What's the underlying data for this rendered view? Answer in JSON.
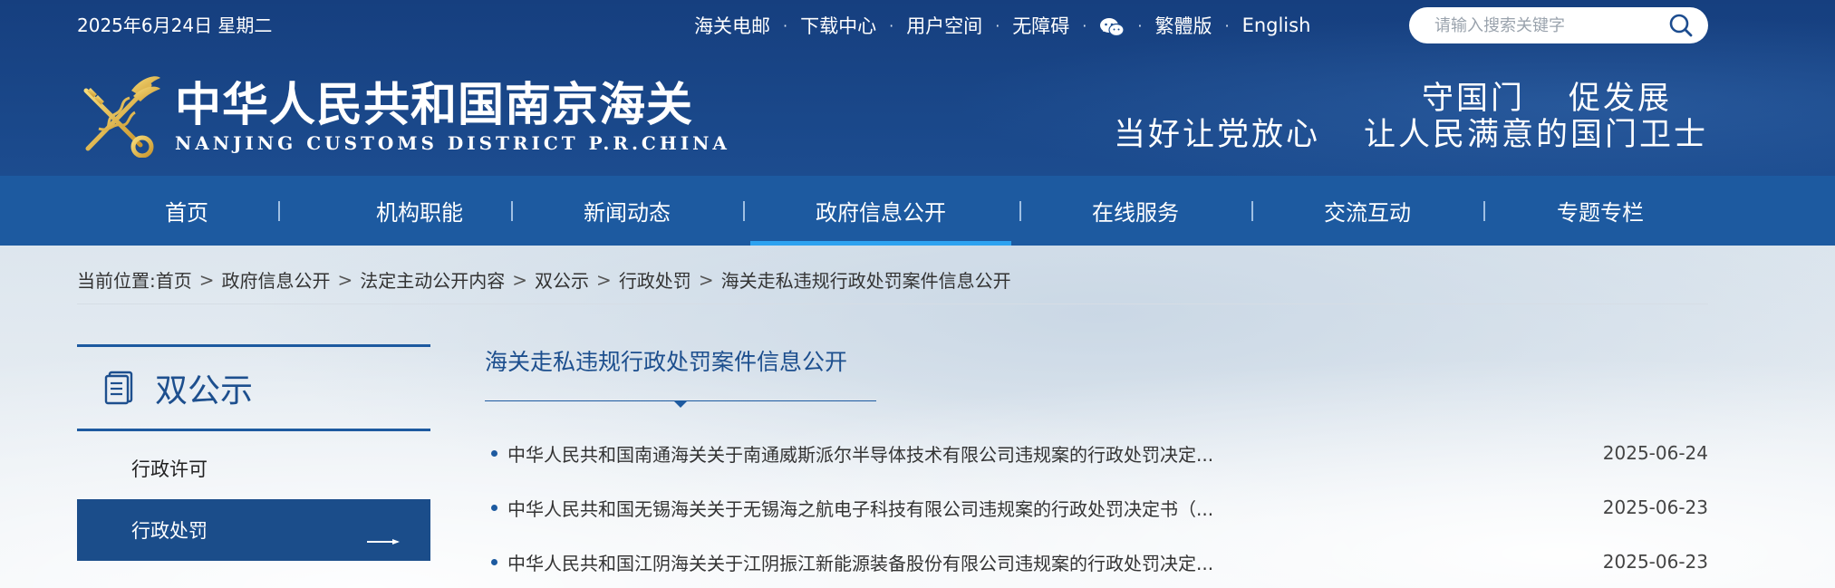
{
  "header": {
    "date": "2025年6月24日 星期二",
    "top_links": [
      "海关电邮",
      "下载中心",
      "用户空间",
      "无障碍"
    ],
    "wechat_icon": "wechat-icon",
    "lang_links": [
      "繁體版",
      "English"
    ],
    "search": {
      "placeholder": "请输入搜索关键字"
    },
    "site_title": "中华人民共和国南京海关",
    "site_subtitle": "NANJING CUSTOMS DISTRICT P.R.CHINA",
    "slogan_line1": [
      "守国门",
      "促发展"
    ],
    "slogan_line2": [
      "当好让党放心",
      "让人民满意的国门卫士"
    ]
  },
  "nav": {
    "items": [
      "首页",
      "机构职能",
      "新闻动态",
      "政府信息公开",
      "在线服务",
      "交流互动",
      "专题专栏"
    ],
    "active": "政府信息公开"
  },
  "breadcrumb": {
    "prefix": "当前位置:",
    "items": [
      "首页",
      "政府信息公开",
      "法定主动公开内容",
      "双公示",
      "行政处罚",
      "海关走私违规行政处罚案件信息公开"
    ]
  },
  "sidebar": {
    "title": "双公示",
    "items": [
      "行政许可",
      "行政处罚"
    ],
    "active": "行政处罚"
  },
  "list": {
    "title": "海关走私违规行政处罚案件信息公开",
    "rows": [
      {
        "title": "中华人民共和国南通海关关于南通威斯派尔半导体技术有限公司违规案的行政处罚决定...",
        "date": "2025-06-24"
      },
      {
        "title": "中华人民共和国无锡海关关于无锡海之航电子科技有限公司违规案的行政处罚决定书（...",
        "date": "2025-06-23"
      },
      {
        "title": "中华人民共和国江阴海关关于江阴振江新能源装备股份有限公司违规案的行政处罚决定...",
        "date": "2025-06-23"
      }
    ]
  },
  "colors": {
    "header_bg": "#163f7f",
    "nav_bg": "#1d5aa0",
    "nav_active_underline": "#2da2f0",
    "sidebar_active_bg": "#1b4d8a",
    "title_blue": "#1d4f8e"
  }
}
